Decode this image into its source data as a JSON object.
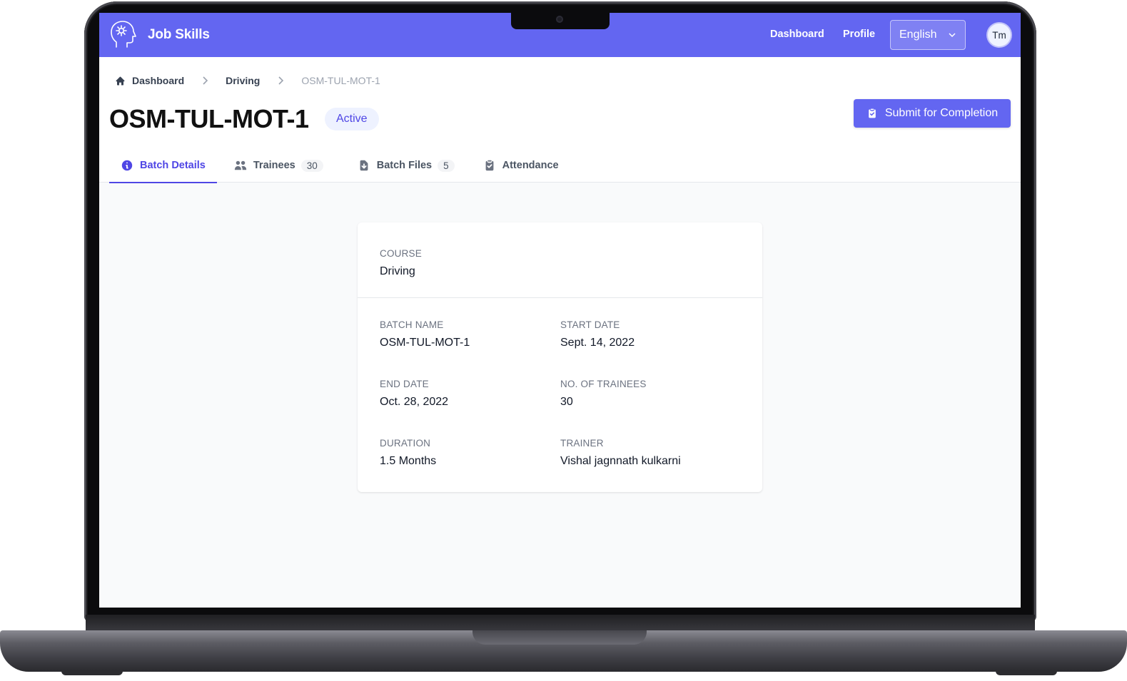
{
  "app": {
    "name": "Job Skills",
    "nav": {
      "dashboard": "Dashboard",
      "profile": "Profile"
    },
    "language": "English",
    "avatar_initials": "Tm"
  },
  "breadcrumb": {
    "home": "Dashboard",
    "course": "Driving",
    "current": "OSM-TUL-MOT-1"
  },
  "page": {
    "title": "OSM-TUL-MOT-1",
    "status": "Active",
    "submit_label": "Submit for Completion"
  },
  "tabs": [
    {
      "label": "Batch Details",
      "icon": "info-circle-icon",
      "active": true
    },
    {
      "label": "Trainees",
      "icon": "users-icon",
      "count": "30"
    },
    {
      "label": "Batch Files",
      "icon": "document-download-icon",
      "count": "5"
    },
    {
      "label": "Attendance",
      "icon": "clipboard-check-icon"
    }
  ],
  "details": {
    "course": {
      "label": "Course",
      "value": "Driving"
    },
    "batch_name": {
      "label": "Batch name",
      "value": "OSM-TUL-MOT-1"
    },
    "start_date": {
      "label": "Start date",
      "value": "Sept. 14, 2022"
    },
    "end_date": {
      "label": "End date",
      "value": "Oct. 28, 2022"
    },
    "trainees": {
      "label": "No. of trainees",
      "value": "30"
    },
    "duration": {
      "label": "Duration",
      "value": "1.5 Months"
    },
    "trainer": {
      "label": "Trainer",
      "value": "Vishal jagnnath kulkarni"
    }
  },
  "colors": {
    "primary": "#6366f1",
    "primary_dark": "#4f46e5",
    "badge_bg": "#eef2ff"
  }
}
